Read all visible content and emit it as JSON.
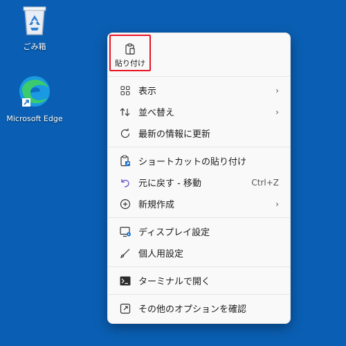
{
  "desktop": {
    "recycle_bin_label": "ごみ箱",
    "edge_label": "Microsoft Edge"
  },
  "menu": {
    "paste_label": "貼り付け",
    "view_label": "表示",
    "sort_label": "並べ替え",
    "refresh_label": "最新の情報に更新",
    "paste_shortcut_label": "ショートカットの貼り付け",
    "undo_label": "元に戻す - 移動",
    "undo_shortcut": "Ctrl+Z",
    "new_label": "新規作成",
    "display_settings_label": "ディスプレイ設定",
    "personalize_label": "個人用設定",
    "terminal_label": "ターミナルで開く",
    "more_options_label": "その他のオプションを確認"
  }
}
